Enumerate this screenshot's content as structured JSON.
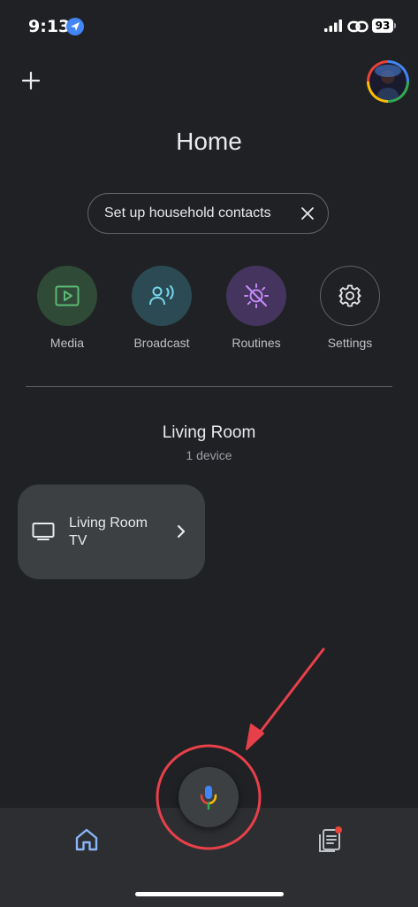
{
  "status_bar": {
    "time": "9:13",
    "battery": "93"
  },
  "header": {
    "title": "Home"
  },
  "chip": {
    "label": "Set up household contacts"
  },
  "quick_actions": [
    {
      "label": "Media",
      "icon": "play-icon",
      "color": "#5bb974",
      "bg": "#2f4a36"
    },
    {
      "label": "Broadcast",
      "icon": "broadcast-icon",
      "color": "#78d9ec",
      "bg": "#2b4a54"
    },
    {
      "label": "Routines",
      "icon": "sun-off-icon",
      "color": "#c58af9",
      "bg": "#45345e"
    },
    {
      "label": "Settings",
      "icon": "gear-icon",
      "color": "#e8eaed",
      "bg": "#202124"
    }
  ],
  "room": {
    "name": "Living Room",
    "device_count": "1 device",
    "devices": [
      {
        "name": "Living Room TV",
        "icon": "tv-icon"
      }
    ]
  },
  "bottom_nav": {
    "items": [
      {
        "name": "home",
        "icon": "home-icon",
        "active": true
      },
      {
        "name": "feed",
        "icon": "feed-icon",
        "badge": true
      }
    ]
  },
  "colors": {
    "background": "#202124",
    "accent_blue": "#8ab4f8",
    "annotation_red": "#e8404a"
  }
}
